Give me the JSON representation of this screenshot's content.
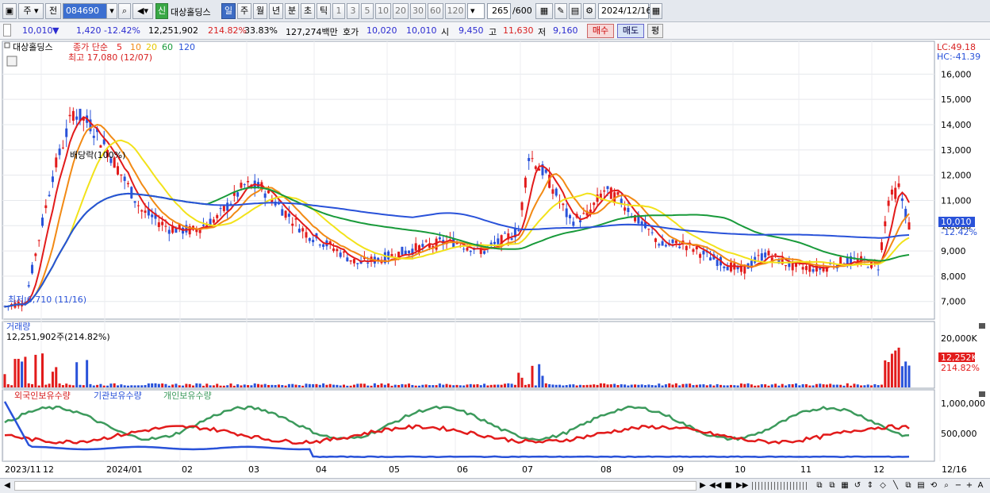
{
  "toolbar": {
    "market": "주",
    "prev_label": "전",
    "code": "084690",
    "stock_name": "대상홀딩스",
    "badge": "신",
    "periods": [
      "일",
      "주",
      "월",
      "년",
      "분",
      "초",
      "틱"
    ],
    "selected_period": "일",
    "intervals": [
      "1",
      "3",
      "5",
      "10",
      "20",
      "30",
      "60",
      "120"
    ],
    "count": "265",
    "count_total": "/600",
    "date": "2024/12/16"
  },
  "quote": {
    "price": "10,010",
    "arrow": "▼",
    "change": "1,420",
    "change_pct": "-12.42%",
    "volume": "12,251,902",
    "volume_ratio": "214.82%",
    "turnover": "33.83%",
    "amount": "127,274백만",
    "ask_label": "호가",
    "ask": "10,020",
    "bid": "10,010",
    "open_label": "시",
    "open": "9,450",
    "high_label": "고",
    "high": "11,630",
    "low_label": "저",
    "low": "9,160",
    "buy_label": "매수",
    "sell_label": "매도",
    "eval_label": "평"
  },
  "price_panel": {
    "legend_name": "대상홀딩스",
    "legend_close": "종가 단순",
    "legend_ma": [
      "5",
      "10",
      "20",
      "60",
      "120"
    ],
    "high_note": "최고 17,080 (12/07)",
    "low_note": "최저 6,710 (11/16)",
    "dividend_note": "배당락(100%)",
    "lc": "LC:49.18",
    "hc": "HC:-41.39",
    "last_price_tag": "10,010",
    "last_pct_tag": "-12.42%"
  },
  "volume_panel": {
    "title": "거래량",
    "value": "12,251,902주(214.82%)",
    "axis_label": "20,000K",
    "tag_value": "12,252K",
    "tag_pct": "214.82%"
  },
  "holdings_panel": {
    "legend": [
      "외국인보유수량",
      "기관보유수량",
      "개인보유수량"
    ],
    "axis": [
      "1,000,000",
      "500,000"
    ]
  },
  "x_axis": {
    "labels": [
      "2023/11",
      "12",
      "2024/01",
      "02",
      "03",
      "04",
      "05",
      "06",
      "07",
      "08",
      "09",
      "10",
      "11",
      "12",
      "12/16"
    ]
  },
  "chart_data": {
    "type": "candlestick",
    "y_ticks": [
      7000,
      8000,
      9000,
      10000,
      11000,
      12000,
      13000,
      14000,
      15000,
      16000
    ],
    "ylim": [
      6300,
      17300
    ],
    "ma_periods": [
      5,
      10,
      20,
      60,
      120
    ],
    "ma_colors": [
      "#e21b1b",
      "#f28a14",
      "#f2e21a",
      "#189a3a",
      "#2952d9"
    ],
    "bar_count": 265,
    "last_close": 10010,
    "period_high": 17080,
    "period_low": 6710,
    "volume_axis_tick": 20000000,
    "holdings_ticks": [
      500000,
      1000000
    ]
  },
  "colors": {
    "up": "#e21b1b",
    "down": "#2952d9",
    "foreign": "#e21b1b",
    "institution": "#2952d9",
    "individual": "#3c9a5c"
  }
}
